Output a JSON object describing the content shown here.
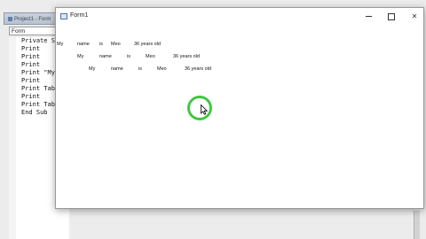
{
  "ide": {
    "title": "Project1 - Form",
    "object_combo": "Form",
    "code_lines": [
      "Private S",
      "Print",
      "Print",
      "Print",
      "Print \"My",
      "Print",
      "Print Tab",
      "Print",
      "Print Tab",
      "End Sub"
    ]
  },
  "form": {
    "title": "Form1",
    "buttons": {
      "minimize": "minimize",
      "maximize": "maximize",
      "close": "✕"
    },
    "output": {
      "line1": [
        "My",
        "name",
        "is",
        "Meo",
        "36 years old"
      ],
      "line2": [
        "My",
        "name",
        "is",
        "Meo",
        "36 years old"
      ],
      "line3": [
        "My",
        "name",
        "is",
        "Meo",
        "36 years old"
      ]
    }
  },
  "colors": {
    "click_ring": "#42c742"
  }
}
